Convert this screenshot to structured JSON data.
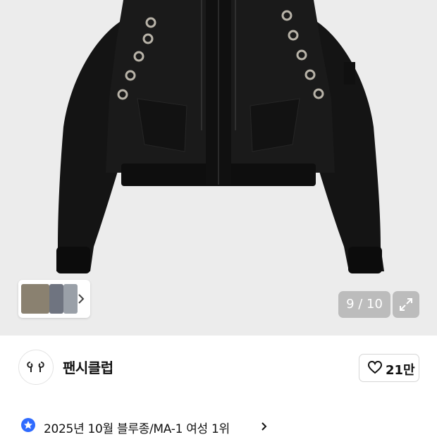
{
  "gallery": {
    "counter": "9 / 10",
    "image_alt": "black bomber jacket with eyelets",
    "expand_icon": "expand-icon",
    "thumbnails": [
      "thumb-1",
      "thumb-2",
      "thumb-3"
    ]
  },
  "shop": {
    "name": "팬시클럽",
    "logo_icon": "fancy-club-logo",
    "like_count": "21만",
    "like_icon": "heart-outline-icon"
  },
  "ranking": {
    "text": "2025년 10월 블루종/MA-1 여성 1위",
    "badge_color": "#2f6bff"
  }
}
